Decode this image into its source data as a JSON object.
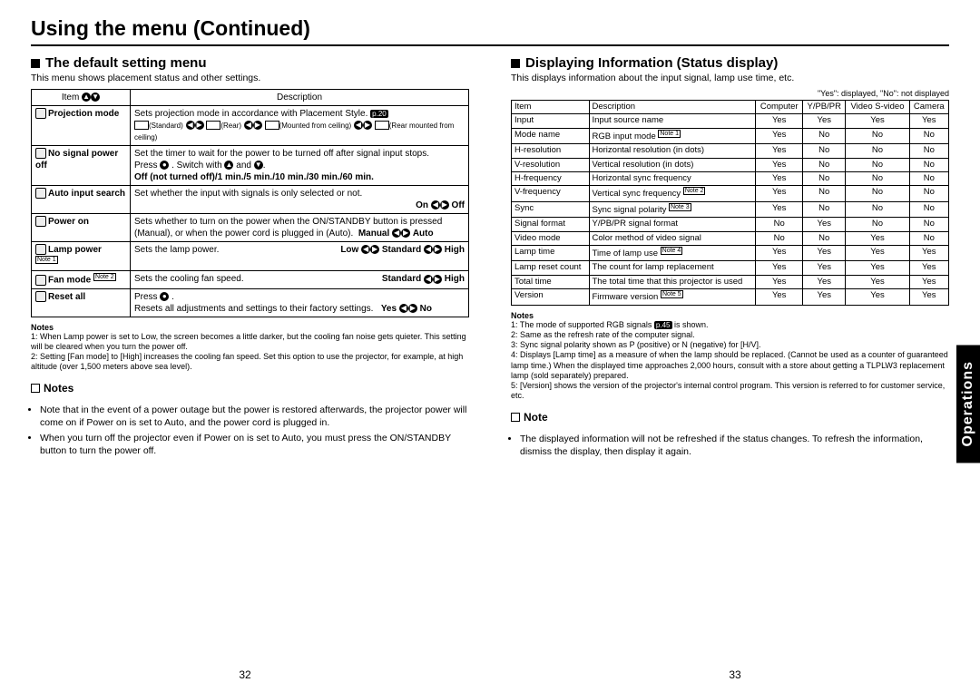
{
  "title": "Using the menu (Continued)",
  "side_tab": "Operations",
  "left": {
    "heading": "The default setting menu",
    "sub": "This menu shows placement status and other settings.",
    "table_headers": [
      "Item",
      "Description"
    ],
    "rows": [
      {
        "item": "Projection mode",
        "desc_line1": "Sets projection mode in accordance with Placement Style.",
        "page_ref": "p.20",
        "proj_modes": [
          "(Standard)",
          "(Rear)",
          "(Mounted from ceiling)",
          "(Rear mounted from ceiling)"
        ]
      },
      {
        "item": "No signal power off",
        "desc_line1": "Set the timer to wait for the power to be turned off after signal input stops.",
        "desc_line2_a": "Press ",
        "desc_line2_b": ". Switch with ",
        "desc_line2_c": " and ",
        "desc_line3": "Off (not turned off)/1 min./5 min./10 min./30 min./60 min."
      },
      {
        "item": "Auto input search",
        "desc_line1": "Set whether the input with signals is only selected or not.",
        "toggle": [
          "On",
          "Off"
        ]
      },
      {
        "item": "Power on",
        "desc_line1": "Sets whether to turn on the power when the ON/STANDBY button is pressed (Manual), or when the power cord is plugged in (Auto).",
        "toggle": [
          "Manual",
          "Auto"
        ]
      },
      {
        "item": "Lamp power",
        "note_sup": "Note 1",
        "desc_line1": "Sets the lamp power.",
        "options": [
          "Low",
          "Standard",
          "High"
        ]
      },
      {
        "item": "Fan mode",
        "note_sup": "Note 2",
        "desc_line1": "Sets the cooling fan speed.",
        "options": [
          "Standard",
          "High"
        ]
      },
      {
        "item": "Reset all",
        "desc_line1_a": "Press ",
        "desc_line2": "Resets all adjustments and settings to their factory settings.",
        "toggle": [
          "Yes",
          "No"
        ]
      }
    ],
    "notes_header": "Notes",
    "notes": [
      "1: When Lamp power is set to Low, the screen becomes a little darker, but the cooling fan noise gets quieter. This setting will be cleared when you turn the power off.",
      "2: Setting [Fan mode] to [High] increases the cooling fan speed. Set this option to use the projector, for example, at high altitude (over 1,500 meters above sea level)."
    ],
    "sub_heading": "Notes",
    "bullets": [
      "Note that in the event of a power outage but the power is restored afterwards, the projector power will come on if Power on is set to Auto, and the power cord is plugged in.",
      "When you turn off the projector even if Power on is set to Auto, you must press the ON/STANDBY button to turn the power off."
    ],
    "page_number": "32"
  },
  "right": {
    "heading": "Displaying Information (Status display)",
    "sub": "This displays information about the input signal, lamp use time, etc.",
    "legend": "\"Yes\": displayed, \"No\": not displayed",
    "table_headers": [
      "Item",
      "Description",
      "Computer",
      "Y/PB/PR",
      "Video S-video",
      "Camera"
    ],
    "rows": [
      {
        "item": "Input",
        "desc": "Input source name",
        "c": "Yes",
        "y": "Yes",
        "v": "Yes",
        "cam": "Yes"
      },
      {
        "item": "Mode name",
        "desc": "RGB input mode",
        "note": "Note 1",
        "c": "Yes",
        "y": "No",
        "v": "No",
        "cam": "No"
      },
      {
        "item": "H-resolution",
        "desc": "Horizontal resolution (in dots)",
        "c": "Yes",
        "y": "No",
        "v": "No",
        "cam": "No"
      },
      {
        "item": "V-resolution",
        "desc": "Vertical resolution (in dots)",
        "c": "Yes",
        "y": "No",
        "v": "No",
        "cam": "No"
      },
      {
        "item": "H-frequency",
        "desc": "Horizontal sync frequency",
        "c": "Yes",
        "y": "No",
        "v": "No",
        "cam": "No"
      },
      {
        "item": "V-frequency",
        "desc": "Vertical sync frequency",
        "note": "Note 2",
        "c": "Yes",
        "y": "No",
        "v": "No",
        "cam": "No"
      },
      {
        "item": "Sync",
        "desc": "Sync signal polarity",
        "note": "Note 3",
        "c": "Yes",
        "y": "No",
        "v": "No",
        "cam": "No"
      },
      {
        "item": "Signal format",
        "desc": "Y/PB/PR signal format",
        "c": "No",
        "y": "Yes",
        "v": "No",
        "cam": "No"
      },
      {
        "item": "Video mode",
        "desc": "Color method of video signal",
        "c": "No",
        "y": "No",
        "v": "Yes",
        "cam": "No"
      },
      {
        "item": "Lamp time",
        "desc": "Time of lamp use",
        "note": "Note 4",
        "c": "Yes",
        "y": "Yes",
        "v": "Yes",
        "cam": "Yes"
      },
      {
        "item": "Lamp reset count",
        "desc": "The count for lamp replacement",
        "c": "Yes",
        "y": "Yes",
        "v": "Yes",
        "cam": "Yes"
      },
      {
        "item": "Total time",
        "desc": "The total time that this projector is used",
        "c": "Yes",
        "y": "Yes",
        "v": "Yes",
        "cam": "Yes"
      },
      {
        "item": "Version",
        "desc": "Firmware version",
        "note": "Note 5",
        "c": "Yes",
        "y": "Yes",
        "v": "Yes",
        "cam": "Yes"
      }
    ],
    "notes_header": "Notes",
    "notes": [
      {
        "text_a": "1: The mode of supported RGB signals ",
        "ref": "p.45",
        "text_b": " is shown."
      },
      {
        "text_a": "2: Same as the refresh rate of the computer signal."
      },
      {
        "text_a": "3: Sync signal polarity shown as P (positive) or N (negative) for [H/V]."
      },
      {
        "text_a": "4: Displays [Lamp time] as a measure of when the lamp should be replaced. (Cannot be used as a counter of guaranteed lamp time.) When the displayed time approaches 2,000 hours, consult with a store about getting a TLPLW3 replacement lamp (sold separately) prepared."
      },
      {
        "text_a": "5: [Version] shows the version of the projector's internal control program. This version is referred to for customer service, etc."
      }
    ],
    "sub_heading": "Note",
    "bullets": [
      "The displayed information will not be refreshed if the status changes. To refresh the information, dismiss the display, then display it again."
    ],
    "page_number": "33"
  }
}
